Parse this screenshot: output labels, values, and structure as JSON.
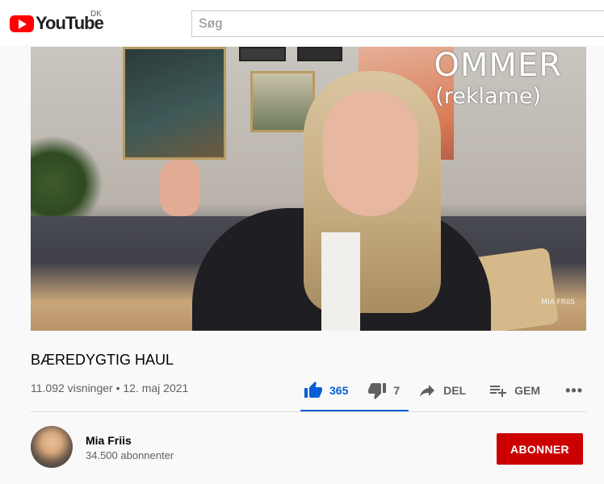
{
  "header": {
    "logo_text": "YouTube",
    "country_code": "DK",
    "search_placeholder": "Søg"
  },
  "video": {
    "overlay_title": "OMMER",
    "overlay_subtitle": "(reklame)",
    "watermark": "MIA FRIIS"
  },
  "info": {
    "title": "BÆREDYGTIG HAUL",
    "meta": "11.092 visninger • 12. maj 2021"
  },
  "actions": {
    "likes": "365",
    "dislikes": "7",
    "share_label": "DEL",
    "save_label": "GEM",
    "more_label": "•••"
  },
  "channel": {
    "name": "Mia Friis",
    "subscribers": "34.500 abonnenter",
    "subscribe_label": "ABONNER"
  },
  "colors": {
    "brand_red": "#ff0000",
    "subscribe_red": "#cc0000",
    "like_blue": "#065fd4"
  },
  "icons": [
    "youtube-logo-icon",
    "thumbs-up-icon",
    "thumbs-down-icon",
    "share-icon",
    "playlist-add-icon",
    "more-icon"
  ]
}
